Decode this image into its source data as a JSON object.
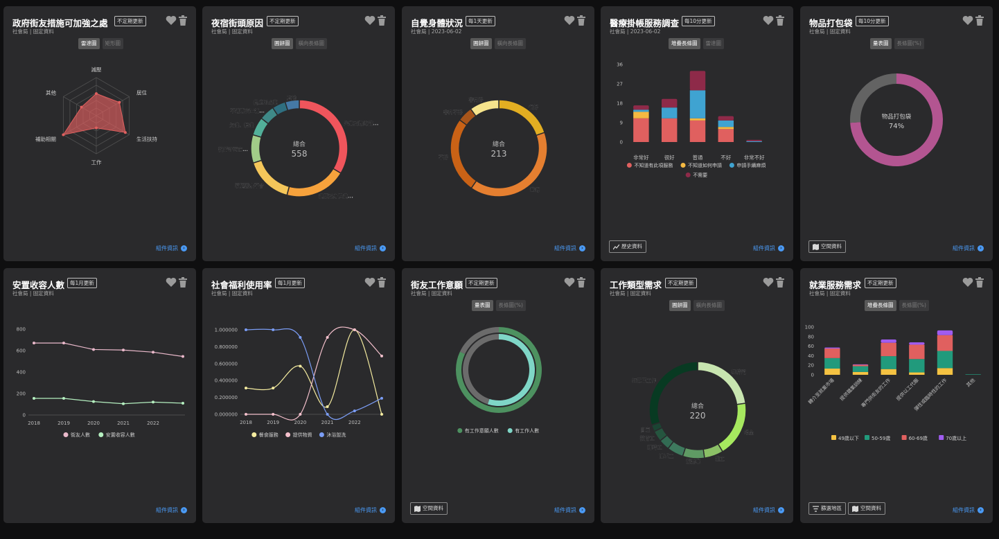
{
  "colors": {
    "card_bg": "#2a2a2c",
    "link": "#4a9af5"
  },
  "footer": {
    "info_label": "組件資訊",
    "history_label": "歷史資料",
    "map_label": "空間資料",
    "filter_label": "篩選地區"
  },
  "cards": [
    {
      "title": "政府街友措施可加強之處",
      "badge": "不定期更新",
      "subtitle": "社會局 | 固定資料",
      "toggles": [
        "雷達圖",
        "矩形圖"
      ],
      "chart_data": {
        "type": "radar",
        "axes": [
          "減壓",
          "居住",
          "生活扶持",
          "工作",
          "補助相關",
          "其他"
        ],
        "values": [
          58,
          70,
          88,
          32,
          100,
          45
        ],
        "max": 100,
        "color": "#e0605f"
      }
    },
    {
      "title": "夜宿街頭原因",
      "badge": "不定期更新",
      "subtitle": "社會局 | 固定資料",
      "toggles": [
        "圓餅圖",
        "橫向長條圖"
      ],
      "chart_data": {
        "type": "pie",
        "center_label": "總合",
        "total": "558",
        "labels": [
          "失業或賺的錢...",
          "健康或身體健...",
          "家庭因素不合",
          "親婚者死亡...",
          "欠債、躲債",
          "不適應安置機...",
          "從監所出來",
          "其他"
        ],
        "values": [
          164,
          100,
          78,
          46,
          30,
          25,
          22,
          23
        ],
        "colors": [
          "#f0555c",
          "#f6a23c",
          "#f4c65a",
          "#a1cc88",
          "#52b09a",
          "#3f8a88",
          "#2f6f80",
          "#4579a6"
        ]
      }
    },
    {
      "title": "自覺身體狀況",
      "badge": "每1天更新",
      "subtitle": "社會局 | 2023-06-02",
      "toggles": [
        "圓餅圖",
        "橫向長條圖"
      ],
      "chart_data": {
        "type": "pie",
        "center_label": "總合",
        "total": "213",
        "labels": [
          "很好",
          "普通",
          "不好",
          "非常不好",
          "非常好"
        ],
        "values": [
          42,
          85,
          54,
          11,
          21
        ],
        "colors": [
          "#e2ae22",
          "#e57f30",
          "#c96216",
          "#a8551a",
          "#f6e48c"
        ]
      }
    },
    {
      "title": "醫療掛帳服務調查",
      "badge": "每10分更新",
      "subtitle": "社會局 | 2023-06-02",
      "toggles": [
        "堆疊長條圖",
        "雷達圖"
      ],
      "chart_data": {
        "type": "bar",
        "categories": [
          "非常好",
          "很好",
          "普通",
          "不好",
          "非常不好"
        ],
        "yticks": [
          0,
          9,
          18,
          27,
          36
        ],
        "ylim": [
          0,
          36
        ],
        "series": [
          {
            "name": "不知道有此項服務",
            "values": [
              11,
              11,
              10,
              6,
              0
            ],
            "color": "#e0605f"
          },
          {
            "name": "不知道如何申請",
            "values": [
              3,
              0,
              1,
              1,
              0
            ],
            "color": "#f4b942"
          },
          {
            "name": "申請手續麻煩",
            "values": [
              1,
              5,
              13,
              3,
              0.4
            ],
            "color": "#3fa3d1"
          },
          {
            "name": "不需要",
            "values": [
              2,
              4,
              9,
              2,
              0.6
            ],
            "color": "#8e2a49"
          }
        ]
      }
    },
    {
      "title": "物品打包袋",
      "badge": "每10分更新",
      "subtitle": "社會局 | 固定資料",
      "toggles": [
        "量表圖",
        "長條圖(%)"
      ],
      "chart_data": {
        "type": "gauge",
        "label": "物品打包袋",
        "value": 74,
        "value_label": "74%",
        "colors": [
          "#b35591",
          "#636363"
        ]
      }
    },
    {
      "title": "安置收容人數",
      "badge": "每1月更新",
      "subtitle": "社會局 | 固定資料",
      "toggles": [],
      "chart_data": {
        "type": "line",
        "x": [
          "2018",
          "2019",
          "2020",
          "2021",
          "2022",
          "2023"
        ],
        "xticks": [
          "2018",
          "2019",
          "2020",
          "2021",
          "2022"
        ],
        "yticks": [
          0,
          200,
          400,
          600,
          800
        ],
        "ylim": [
          0,
          800
        ],
        "series": [
          {
            "name": "街友人數",
            "values": [
              670,
              670,
              610,
              605,
              585,
              545
            ],
            "color": "#eab9cb"
          },
          {
            "name": "安置收容人數",
            "values": [
              155,
              155,
              125,
              105,
              120,
              110
            ],
            "color": "#b5f0c0"
          }
        ]
      }
    },
    {
      "title": "社會福利使用率",
      "badge": "每1月更新",
      "subtitle": "社會局 | 固定資料",
      "toggles": [],
      "chart_data": {
        "type": "line",
        "smooth": true,
        "x": [
          "2018",
          "2019",
          "2020",
          "2021",
          "2022",
          "2023"
        ],
        "xticks": [
          "2018",
          "2019",
          "2020",
          "2021",
          "2022"
        ],
        "yticks": [
          "0.000000",
          "0.200000",
          "0.400000",
          "0.600000",
          "0.800000",
          "1.000000"
        ],
        "ylim": [
          0,
          1
        ],
        "series": [
          {
            "name": "餐食服務",
            "values": [
              0.31,
              0.31,
              0.57,
              0.09,
              1.0,
              0.0
            ],
            "color": "#f5eca0"
          },
          {
            "name": "提供物資",
            "values": [
              0.0,
              0.0,
              0.0,
              0.91,
              1.0,
              0.69
            ],
            "color": "#f4c0cc"
          },
          {
            "name": "沐浴盥洗",
            "values": [
              1.0,
              1.0,
              0.91,
              0.0,
              0.04,
              0.19
            ],
            "color": "#7b9df5"
          }
        ]
      }
    },
    {
      "title": "街友工作意願",
      "badge": "不定期更新",
      "subtitle": "社會局 | 固定資料",
      "toggles": [
        "量表圖",
        "長條圖(%)"
      ],
      "chart_data": {
        "type": "gauge",
        "series": [
          {
            "name": "有工作意願人數",
            "value": 0.82,
            "color": "#4d9160"
          },
          {
            "name": "有工作人數",
            "value": 0.55,
            "color": "#7fd6c7"
          }
        ],
        "track_color": "#6b6b6b"
      }
    },
    {
      "title": "工作類型需求",
      "badge": "不定期更新",
      "subtitle": "社會局 | 固定資料",
      "toggles": [
        "圓餅圖",
        "橫向長條圖"
      ],
      "chart_data": {
        "type": "pie",
        "center_label": "總合",
        "total": "220",
        "labels": [
          "無特定",
          "保全",
          "粗工",
          "服務業",
          "清潔工",
          "臨時工",
          "技術工",
          "自雇",
          "無意願工作"
        ],
        "values": [
          50,
          41,
          14,
          16,
          12,
          8,
          8,
          5,
          66
        ],
        "colors": [
          "#c8e5b0",
          "#a6e85f",
          "#8bc066",
          "#5f9a64",
          "#3e7a5e",
          "#326b53",
          "#25553f",
          "#1b4433",
          "#083a22"
        ]
      }
    },
    {
      "title": "就業服務需求",
      "badge": "不定期更新",
      "subtitle": "社會局 | 固定資料",
      "toggles": [
        "堆疊長條圖",
        "長條圖(%)"
      ],
      "chart_data": {
        "type": "bar",
        "categories": [
          "轉介至就業市場",
          "提供職業訓練",
          "專門供街友的工作",
          "提供以工代賑",
          "彈性或臨時性的工作",
          "其他"
        ],
        "yticks": [
          0,
          20,
          40,
          60,
          80,
          100
        ],
        "ylim": [
          0,
          100
        ],
        "series": [
          {
            "name": "49歲以下",
            "values": [
              13,
              6,
              12,
              5,
              14,
              0
            ],
            "color": "#f4c242"
          },
          {
            "name": "50-59歲",
            "values": [
              22,
              12,
              27,
              28,
              36,
              1
            ],
            "color": "#219a7c"
          },
          {
            "name": "60-69歲",
            "values": [
              20,
              3,
              28,
              30,
              33,
              0
            ],
            "color": "#e0605f"
          },
          {
            "name": "70歲以上",
            "values": [
              2,
              1,
              7,
              5,
              10,
              0
            ],
            "color": "#a05cf0"
          }
        ]
      }
    }
  ]
}
